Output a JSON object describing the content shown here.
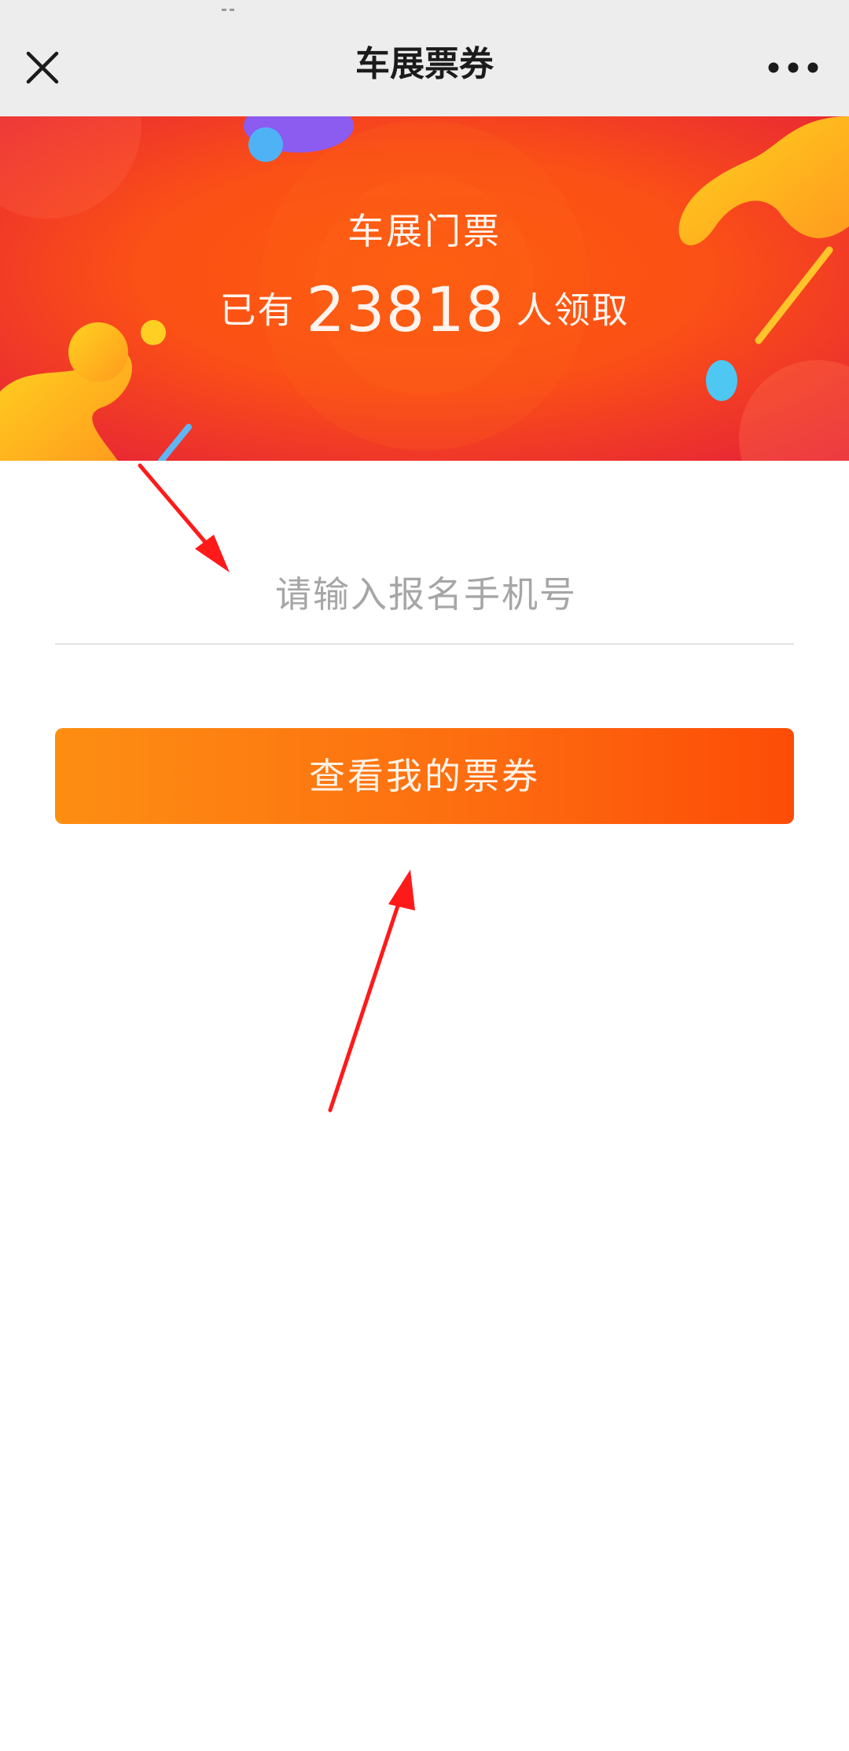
{
  "nav": {
    "title": "车展票券",
    "close_icon": "close-icon",
    "more_icon": "more-dots-icon"
  },
  "banner": {
    "title": "车展门票",
    "prefix": "已有",
    "count": "23818",
    "suffix": "人领取"
  },
  "form": {
    "phone_placeholder": "请输入报名手机号",
    "phone_value": "",
    "submit_label": "查看我的票券"
  },
  "colors": {
    "nav_bg": "#ededed",
    "banner_orange": "#fd5f1b",
    "banner_red": "#e5213a",
    "button_start": "#fd8e12",
    "button_end": "#fd4c07",
    "annotation_red": "#ff1a1a"
  }
}
